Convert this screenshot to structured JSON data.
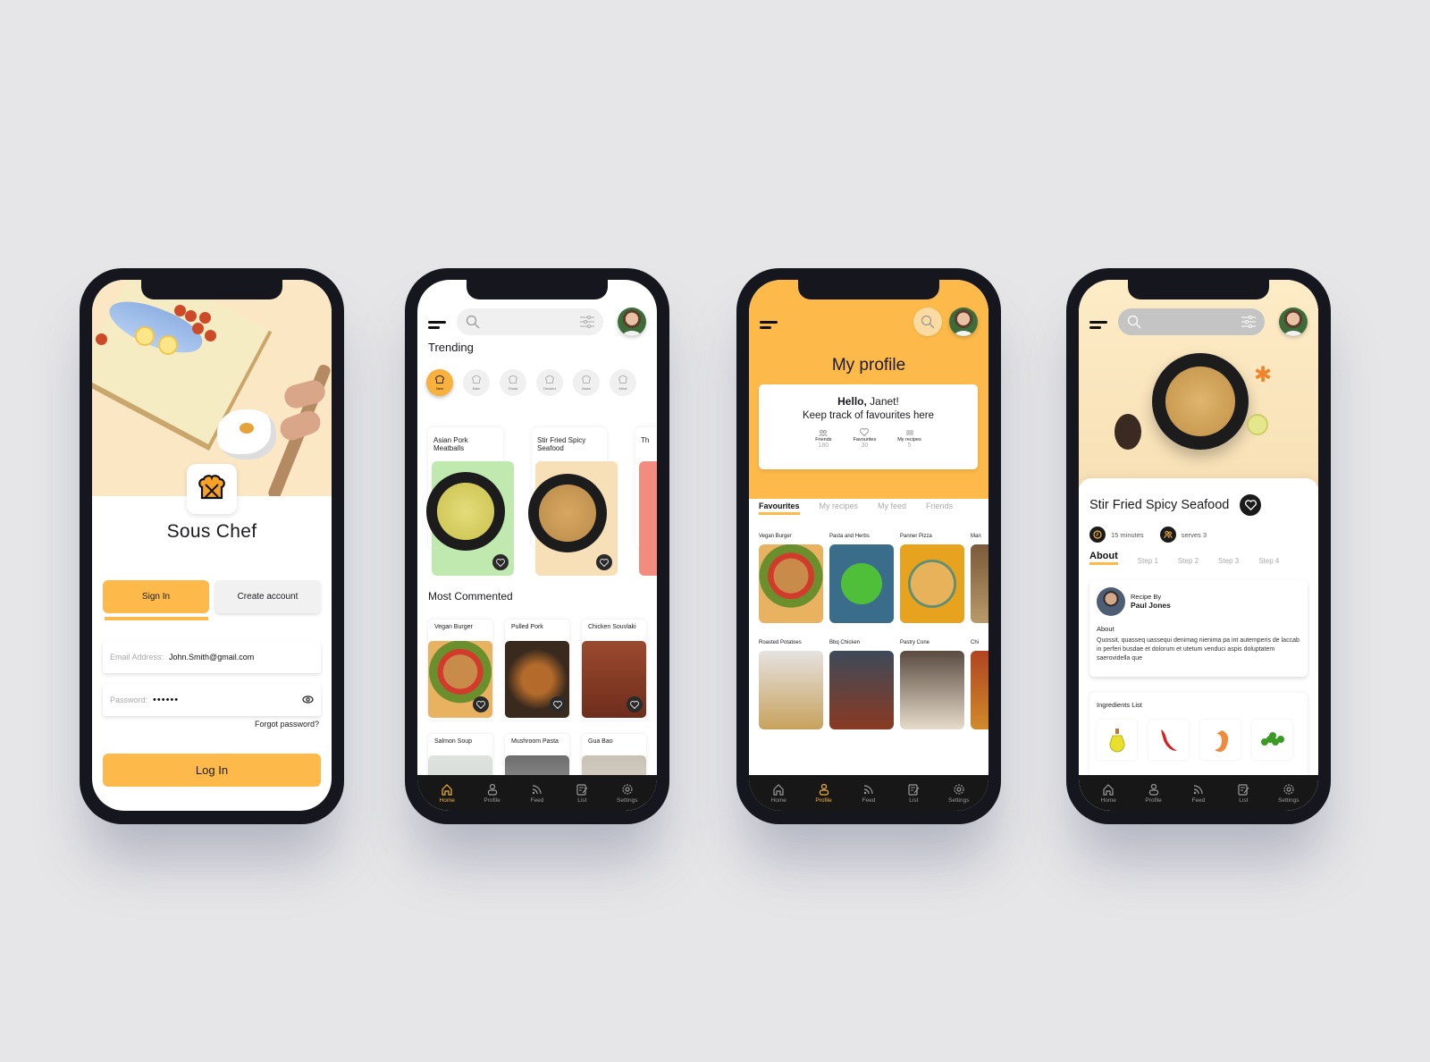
{
  "colors": {
    "accent": "#fdba4a",
    "background": "#e6e6e8",
    "phone_frame": "#16161e",
    "nav_bar": "#171717",
    "nav_active": "#f4b23e",
    "nav_inactive": "#9a9a9a"
  },
  "bottom_nav": [
    {
      "label": "Home",
      "icon": "home-icon"
    },
    {
      "label": "Profile",
      "icon": "profile-icon"
    },
    {
      "label": "Feed",
      "icon": "feed-icon"
    },
    {
      "label": "List",
      "icon": "list-icon"
    },
    {
      "label": "Settings",
      "icon": "settings-icon"
    }
  ],
  "login": {
    "app_title": "Sous Chef",
    "logo_icon": "chef-hat-utensils-icon",
    "tabs": {
      "sign_in": "Sign In",
      "create_account": "Create account"
    },
    "email": {
      "label": "Email Address:",
      "value": "John.Smith@gmail.com"
    },
    "password": {
      "label": "Password:",
      "value": "••••••"
    },
    "forgot": "Forgot password?",
    "login_button": "Log In"
  },
  "home": {
    "active_nav": "Home",
    "trending_title": "Trending",
    "categories": [
      {
        "label": "New",
        "icon": "chef-hat-icon",
        "active": true
      },
      {
        "label": "Main",
        "icon": "plate-cutlery-icon",
        "active": false
      },
      {
        "label": "Pasta",
        "icon": "noodle-bowl-icon",
        "active": false
      },
      {
        "label": "Dessert",
        "icon": "ice-cream-icon",
        "active": false
      },
      {
        "label": "Asian",
        "icon": "wok-icon",
        "active": false
      },
      {
        "label": "Meat",
        "icon": "steak-icon",
        "active": false
      }
    ],
    "trending": [
      {
        "title": "Asian Pork Meatballs",
        "bg": "#bfe9ae"
      },
      {
        "title": "Stir Fried Spicy Seafood",
        "bg": "#f7e0b7"
      },
      {
        "title": "Th",
        "bg": "#f28c7e"
      }
    ],
    "most_commented_title": "Most Commented",
    "most_commented": [
      {
        "title": "Vegan Burger"
      },
      {
        "title": "Pulled Pork"
      },
      {
        "title": "Chicken Souvlaki"
      },
      {
        "title": "Salmon Soup"
      },
      {
        "title": "Mushroom Pasta"
      },
      {
        "title": "Gua Bao"
      }
    ]
  },
  "profile": {
    "active_nav": "Profile",
    "title": "My profile",
    "greeting_bold": "Hello,",
    "greeting_name": " Janet!",
    "subtitle": "Keep track of favourites here",
    "stats": [
      {
        "label": "Friends",
        "value": "180",
        "icon": "friends-icon"
      },
      {
        "label": "Favourites",
        "value": "30",
        "icon": "heart-icon"
      },
      {
        "label": "My recipes",
        "value": "5",
        "icon": "recipes-stack-icon"
      }
    ],
    "tabs": [
      "Favourites",
      "My recipes",
      "My feed",
      "Friends"
    ],
    "active_tab": "Favourites",
    "favourites": [
      {
        "title": "Vegan Burger"
      },
      {
        "title": "Pasta and Herbs"
      },
      {
        "title": "Panner Pizza"
      },
      {
        "title": "Man"
      },
      {
        "title": "Roasted Potatoes"
      },
      {
        "title": "Bbq Chicken"
      },
      {
        "title": "Pastry Cone"
      },
      {
        "title": "Chi"
      }
    ]
  },
  "recipe": {
    "active_nav": "",
    "title": "Stir Fried Spicy Seafood",
    "time": "15 minutes",
    "serves": "serves 3",
    "tabs": [
      "About",
      "Step 1",
      "Step 2",
      "Step 3",
      "Step 4"
    ],
    "active_tab": "About",
    "author_label": "Recipe By",
    "author_name": "Paul Jones",
    "about_heading": "About",
    "about_text": "Quossit, quasseq uassequi denimag nienima pa int autemperis de laccab in perferi busdae et dolorum et utetum venduci aspis doluptatem saerovidella que",
    "ingredients_heading": "Ingredients List",
    "ingredients": [
      "olive-oil",
      "red-chili",
      "shrimp",
      "green-peas"
    ]
  }
}
